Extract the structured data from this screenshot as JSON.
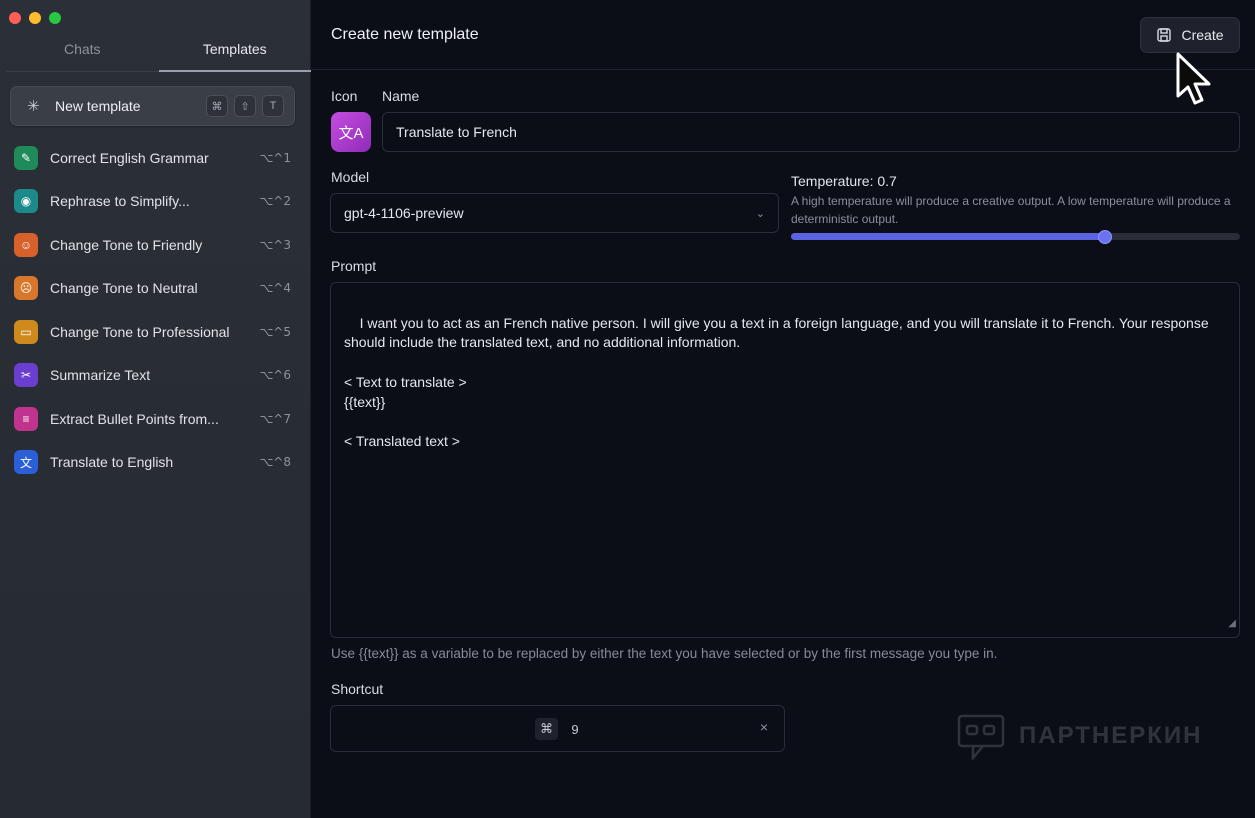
{
  "sidebar": {
    "tabs": [
      {
        "label": "Chats",
        "active": false
      },
      {
        "label": "Templates",
        "active": true
      }
    ],
    "new_template": {
      "label": "New template",
      "shortcut": [
        "⌘",
        "⇧",
        "T"
      ]
    },
    "templates": [
      {
        "label": "Correct English Grammar",
        "shortcut": "⌥^1",
        "icon": "pencil-icon",
        "color": "#1f8a5a"
      },
      {
        "label": "Rephrase to Simplify...",
        "shortcut": "⌥^2",
        "icon": "lightbulb-icon",
        "color": "#1c8a8a"
      },
      {
        "label": "Change Tone to Friendly",
        "shortcut": "⌥^3",
        "icon": "smile-icon",
        "color": "#d8602a"
      },
      {
        "label": "Change Tone to Neutral",
        "shortcut": "⌥^4",
        "icon": "neutral-face-icon",
        "color": "#d8762a"
      },
      {
        "label": "Change Tone to Professional",
        "shortcut": "⌥^5",
        "icon": "briefcase-icon",
        "color": "#cf8a1e"
      },
      {
        "label": "Summarize Text",
        "shortcut": "⌥^6",
        "icon": "scissors-icon",
        "color": "#6a3fd0"
      },
      {
        "label": "Extract Bullet Points from...",
        "shortcut": "⌥^7",
        "icon": "list-icon",
        "color": "#c0338f"
      },
      {
        "label": "Translate to English",
        "shortcut": "⌥^8",
        "icon": "translate-icon",
        "color": "#2a5fd8"
      }
    ]
  },
  "header": {
    "title": "Create new template",
    "create_label": "Create"
  },
  "form": {
    "icon_label": "Icon",
    "name_label": "Name",
    "name_value": "Translate to French",
    "model_label": "Model",
    "model_value": "gpt-4-1106-preview",
    "temperature_title": "Temperature: 0.7",
    "temperature_value": 0.7,
    "temperature_desc": "A high temperature will produce a creative output. A low temperature will produce a deterministic output.",
    "prompt_label": "Prompt",
    "prompt_value": "I want you to act as an French native person. I will give you a text in a foreign language, and you will translate it to French. Your response should include the translated text, and no additional information.\n\n< Text to translate >\n{{text}}\n\n< Translated text >",
    "hint": "Use {{text}} as a variable to be replaced by either the text you have selected or by the first message you type in.",
    "shortcut_label": "Shortcut",
    "shortcut_keys": [
      "⌘",
      "9"
    ],
    "clear_symbol": "×"
  },
  "watermark": "ПАРТНЕРКИН",
  "colors": {
    "accent": "#5b63e0",
    "icon_gradient": "#c64de0"
  }
}
